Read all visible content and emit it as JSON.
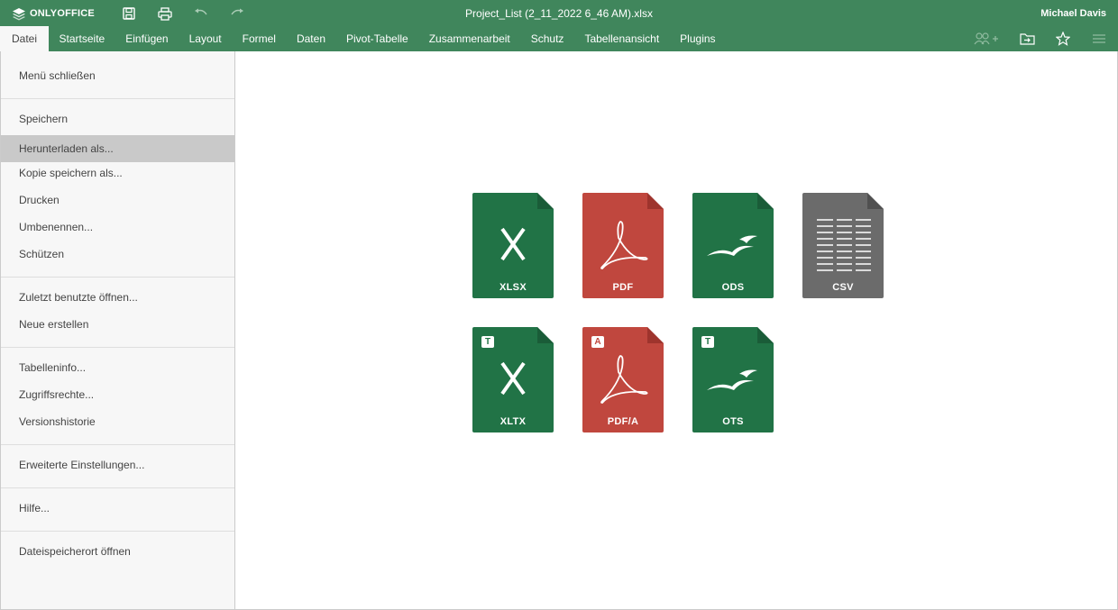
{
  "app": {
    "brand": "ONLYOFFICE",
    "document_title": "Project_List (2_11_2022 6_46 AM).xlsx",
    "user": "Michael Davis"
  },
  "colors": {
    "header": "#40865c",
    "xlsx": "#217346",
    "pdf": "#c0473e",
    "csv": "#6b6b6b",
    "menu_bg": "#f7f7f7",
    "menu_selected": "#c9c9c9"
  },
  "tabs": [
    {
      "label": "Datei",
      "active": true
    },
    {
      "label": "Startseite"
    },
    {
      "label": "Einfügen"
    },
    {
      "label": "Layout"
    },
    {
      "label": "Formel"
    },
    {
      "label": "Daten"
    },
    {
      "label": "Pivot-Tabelle"
    },
    {
      "label": "Zusammenarbeit"
    },
    {
      "label": "Schutz"
    },
    {
      "label": "Tabellenansicht"
    },
    {
      "label": "Plugins"
    }
  ],
  "menu": {
    "items": [
      "Menü schließen",
      "Speichern",
      "Herunterladen als...",
      "Kopie speichern als...",
      "Drucken",
      "Umbenennen...",
      "Schützen",
      "Zuletzt benutzte öffnen...",
      "Neue erstellen",
      "Tabelleninfo...",
      "Zugriffsrechte...",
      "Versionshistorie",
      "Erweiterte Einstellungen...",
      "Hilfe...",
      "Dateispeicherort öffnen"
    ],
    "selected": "Herunterladen als..."
  },
  "formats": [
    {
      "label": "XLSX",
      "icon": "excel-x-icon"
    },
    {
      "label": "PDF",
      "icon": "acrobat-icon"
    },
    {
      "label": "ODS",
      "icon": "seagulls-icon"
    },
    {
      "label": "CSV",
      "icon": "table-lines-icon"
    },
    {
      "label": "XLTX",
      "icon": "excel-x-icon",
      "badge": "T"
    },
    {
      "label": "PDF/A",
      "icon": "acrobat-icon",
      "badge": "A"
    },
    {
      "label": "OTS",
      "icon": "seagulls-icon",
      "badge": "T"
    }
  ]
}
